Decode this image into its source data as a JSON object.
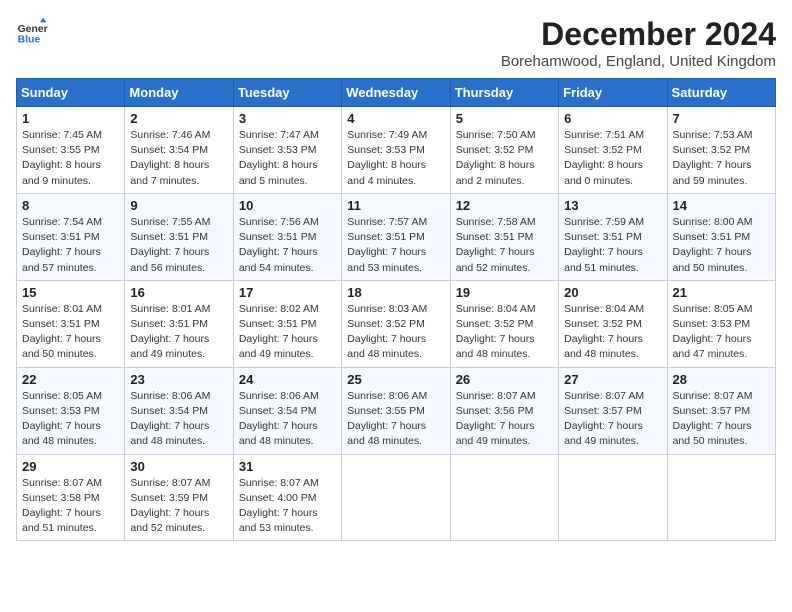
{
  "header": {
    "logo_line1": "General",
    "logo_line2": "Blue",
    "month_year": "December 2024",
    "location": "Borehamwood, England, United Kingdom"
  },
  "weekdays": [
    "Sunday",
    "Monday",
    "Tuesday",
    "Wednesday",
    "Thursday",
    "Friday",
    "Saturday"
  ],
  "weeks": [
    [
      {
        "day": "1",
        "sunrise": "7:45 AM",
        "sunset": "3:55 PM",
        "daylight": "8 hours and 9 minutes."
      },
      {
        "day": "2",
        "sunrise": "7:46 AM",
        "sunset": "3:54 PM",
        "daylight": "8 hours and 7 minutes."
      },
      {
        "day": "3",
        "sunrise": "7:47 AM",
        "sunset": "3:53 PM",
        "daylight": "8 hours and 5 minutes."
      },
      {
        "day": "4",
        "sunrise": "7:49 AM",
        "sunset": "3:53 PM",
        "daylight": "8 hours and 4 minutes."
      },
      {
        "day": "5",
        "sunrise": "7:50 AM",
        "sunset": "3:52 PM",
        "daylight": "8 hours and 2 minutes."
      },
      {
        "day": "6",
        "sunrise": "7:51 AM",
        "sunset": "3:52 PM",
        "daylight": "8 hours and 0 minutes."
      },
      {
        "day": "7",
        "sunrise": "7:53 AM",
        "sunset": "3:52 PM",
        "daylight": "7 hours and 59 minutes."
      }
    ],
    [
      {
        "day": "8",
        "sunrise": "7:54 AM",
        "sunset": "3:51 PM",
        "daylight": "7 hours and 57 minutes."
      },
      {
        "day": "9",
        "sunrise": "7:55 AM",
        "sunset": "3:51 PM",
        "daylight": "7 hours and 56 minutes."
      },
      {
        "day": "10",
        "sunrise": "7:56 AM",
        "sunset": "3:51 PM",
        "daylight": "7 hours and 54 minutes."
      },
      {
        "day": "11",
        "sunrise": "7:57 AM",
        "sunset": "3:51 PM",
        "daylight": "7 hours and 53 minutes."
      },
      {
        "day": "12",
        "sunrise": "7:58 AM",
        "sunset": "3:51 PM",
        "daylight": "7 hours and 52 minutes."
      },
      {
        "day": "13",
        "sunrise": "7:59 AM",
        "sunset": "3:51 PM",
        "daylight": "7 hours and 51 minutes."
      },
      {
        "day": "14",
        "sunrise": "8:00 AM",
        "sunset": "3:51 PM",
        "daylight": "7 hours and 50 minutes."
      }
    ],
    [
      {
        "day": "15",
        "sunrise": "8:01 AM",
        "sunset": "3:51 PM",
        "daylight": "7 hours and 50 minutes."
      },
      {
        "day": "16",
        "sunrise": "8:01 AM",
        "sunset": "3:51 PM",
        "daylight": "7 hours and 49 minutes."
      },
      {
        "day": "17",
        "sunrise": "8:02 AM",
        "sunset": "3:51 PM",
        "daylight": "7 hours and 49 minutes."
      },
      {
        "day": "18",
        "sunrise": "8:03 AM",
        "sunset": "3:52 PM",
        "daylight": "7 hours and 48 minutes."
      },
      {
        "day": "19",
        "sunrise": "8:04 AM",
        "sunset": "3:52 PM",
        "daylight": "7 hours and 48 minutes."
      },
      {
        "day": "20",
        "sunrise": "8:04 AM",
        "sunset": "3:52 PM",
        "daylight": "7 hours and 48 minutes."
      },
      {
        "day": "21",
        "sunrise": "8:05 AM",
        "sunset": "3:53 PM",
        "daylight": "7 hours and 47 minutes."
      }
    ],
    [
      {
        "day": "22",
        "sunrise": "8:05 AM",
        "sunset": "3:53 PM",
        "daylight": "7 hours and 48 minutes."
      },
      {
        "day": "23",
        "sunrise": "8:06 AM",
        "sunset": "3:54 PM",
        "daylight": "7 hours and 48 minutes."
      },
      {
        "day": "24",
        "sunrise": "8:06 AM",
        "sunset": "3:54 PM",
        "daylight": "7 hours and 48 minutes."
      },
      {
        "day": "25",
        "sunrise": "8:06 AM",
        "sunset": "3:55 PM",
        "daylight": "7 hours and 48 minutes."
      },
      {
        "day": "26",
        "sunrise": "8:07 AM",
        "sunset": "3:56 PM",
        "daylight": "7 hours and 49 minutes."
      },
      {
        "day": "27",
        "sunrise": "8:07 AM",
        "sunset": "3:57 PM",
        "daylight": "7 hours and 49 minutes."
      },
      {
        "day": "28",
        "sunrise": "8:07 AM",
        "sunset": "3:57 PM",
        "daylight": "7 hours and 50 minutes."
      }
    ],
    [
      {
        "day": "29",
        "sunrise": "8:07 AM",
        "sunset": "3:58 PM",
        "daylight": "7 hours and 51 minutes."
      },
      {
        "day": "30",
        "sunrise": "8:07 AM",
        "sunset": "3:59 PM",
        "daylight": "7 hours and 52 minutes."
      },
      {
        "day": "31",
        "sunrise": "8:07 AM",
        "sunset": "4:00 PM",
        "daylight": "7 hours and 53 minutes."
      },
      null,
      null,
      null,
      null
    ]
  ]
}
